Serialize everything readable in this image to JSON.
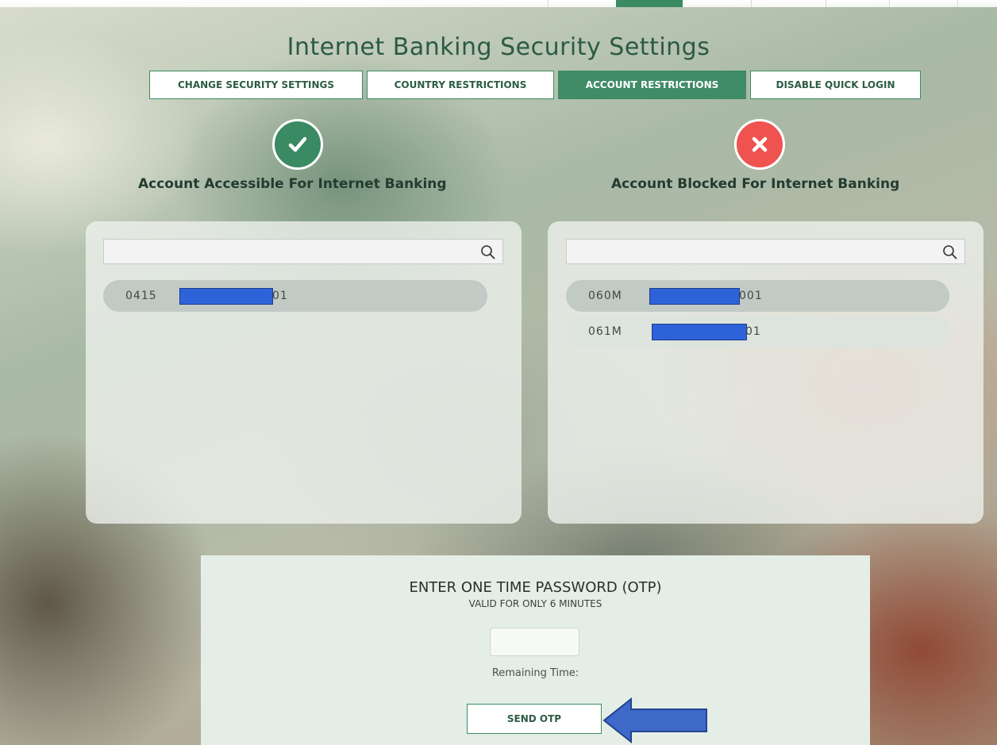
{
  "colors": {
    "accent_green": "#3f8c67",
    "blocked_red": "#ef5350",
    "redaction_blue": "#2e62d8"
  },
  "header": {
    "title": "Internet Banking Security Settings"
  },
  "tabs": [
    {
      "label": "CHANGE SECURITY SETTINGS",
      "active": false
    },
    {
      "label": "COUNTRY RESTRICTIONS",
      "active": false
    },
    {
      "label": "ACCOUNT RESTRICTIONS",
      "active": true
    },
    {
      "label": "DISABLE QUICK LOGIN",
      "active": false
    }
  ],
  "accessible": {
    "icon": "check-icon",
    "title": "Account Accessible For Internet Banking",
    "search_value": "",
    "accounts": [
      {
        "prefix": "0415",
        "suffix": "01",
        "redacted": true
      }
    ]
  },
  "blocked": {
    "icon": "close-icon",
    "title": "Account Blocked For Internet Banking",
    "search_value": "",
    "accounts": [
      {
        "prefix": "060M",
        "suffix": "001",
        "redacted": true
      },
      {
        "prefix": "061M",
        "suffix": "01",
        "redacted": true
      }
    ]
  },
  "otp": {
    "title": "ENTER ONE TIME PASSWORD (OTP)",
    "subtitle": "VALID FOR ONLY 6 MINUTES",
    "input_value": "",
    "remaining_label": "Remaining Time:",
    "send_button": "SEND OTP"
  }
}
